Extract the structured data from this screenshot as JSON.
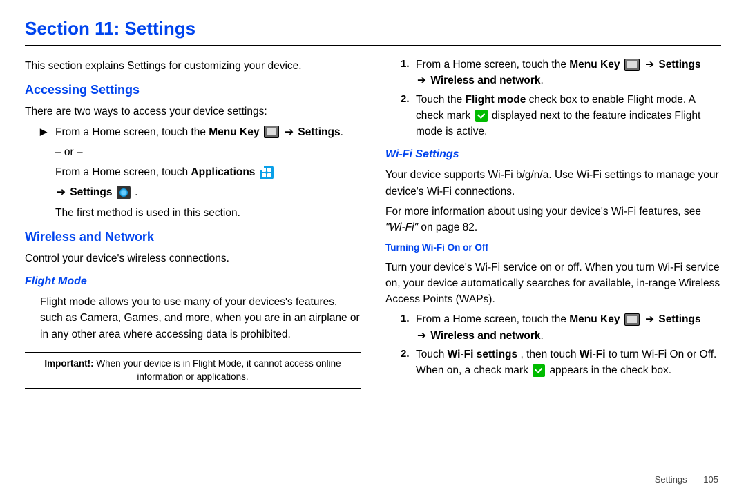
{
  "title": "Section 11: Settings",
  "intro": "This section explains Settings for customizing your device.",
  "accessing": {
    "heading": "Accessing Settings",
    "lead": "There are two ways to access your device settings:",
    "row1_a": "From a Home screen, touch the ",
    "row1_b": "Menu Key",
    "arrow": "➔",
    "row1_c": "Settings",
    "row1_end": ".",
    "or": "– or –",
    "row2_a": "From a Home screen, touch ",
    "row2_b": "Applications",
    "row3_a": "Settings",
    "row3_end": " .",
    "note": "The first method is used in this section."
  },
  "wireless": {
    "heading": "Wireless and Network",
    "lead": "Control your device's wireless connections."
  },
  "flight": {
    "heading": "Flight Mode",
    "para": "Flight mode allows you to use many of your devices's features, such as Camera, Games, and more, when you are in an airplane or in any other area where accessing data is prohibited.",
    "important_label": "Important!:",
    "important_text": " When your device is in Flight Mode, it cannot access online information or applications."
  },
  "right1": {
    "num1": "1.",
    "r1_a": "From a Home screen, touch the ",
    "r1_b": "Menu Key",
    "r1_c": "Settings",
    "r1_d": "Wireless and network",
    "r1_end": ".",
    "num2": "2.",
    "r2_a": "Touch the ",
    "r2_b": "Flight mode",
    "r2_c": " check box to enable Flight mode. A check mark ",
    "r2_d": " displayed next to the feature indicates Flight mode is active."
  },
  "wifi": {
    "heading": "Wi-Fi Settings",
    "p1": "Your device supports Wi-Fi b/g/n/a. Use Wi-Fi settings to manage your device's Wi-Fi connections.",
    "p2_a": "For more information about using your device's Wi-Fi features, see ",
    "p2_ref": "\"Wi-Fi\"",
    "p2_b": " on page 82."
  },
  "wifi_onoff": {
    "heading": "Turning Wi-Fi On or Off",
    "p1": "Turn your device's Wi-Fi service on or off. When you turn Wi-Fi service on, your device automatically searches for available, in-range Wireless Access Points (WAPs).",
    "num1": "1.",
    "s1_a": "From a Home screen, touch the ",
    "s1_b": "Menu Key",
    "s1_c": "Settings",
    "s1_d": "Wireless and network",
    "s1_end": ".",
    "num2": "2.",
    "s2_a": "Touch ",
    "s2_b": "Wi-Fi settings",
    "s2_c": ", then touch ",
    "s2_d": "Wi-Fi",
    "s2_e": " to turn Wi-Fi On or Off. When on, a check mark ",
    "s2_f": " appears in the check box."
  },
  "footer": {
    "label": "Settings",
    "page": "105"
  }
}
